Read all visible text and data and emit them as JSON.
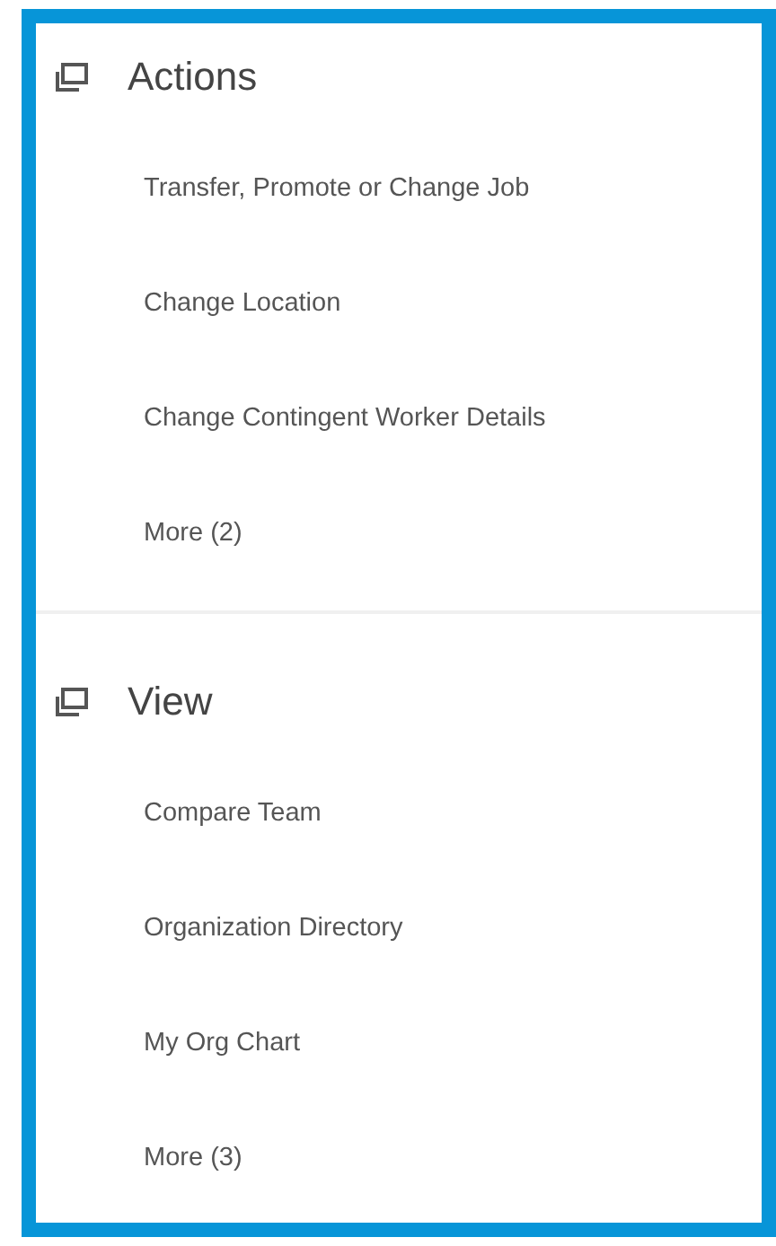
{
  "sections": [
    {
      "title": "Actions",
      "items": [
        "Transfer, Promote or Change Job",
        "Change Location",
        "Change Contingent Worker Details",
        "More (2)"
      ]
    },
    {
      "title": "View",
      "items": [
        "Compare Team",
        "Organization Directory",
        "My Org Chart",
        "More (3)"
      ]
    }
  ]
}
